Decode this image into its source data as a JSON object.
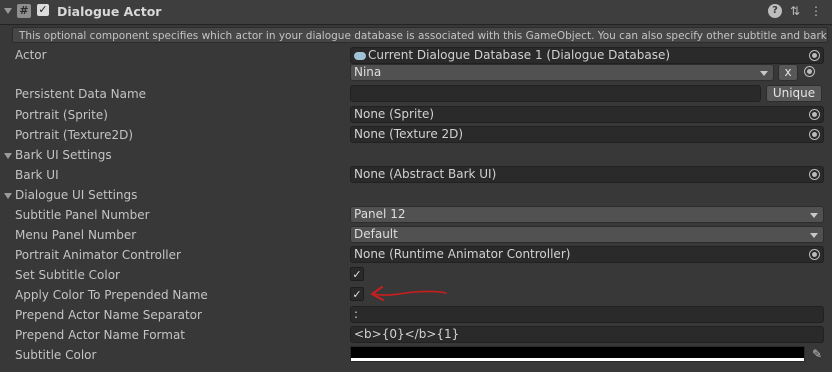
{
  "component": {
    "title": "Dialogue Actor",
    "enabled_check": "✓",
    "help_text": "This optional component specifies which actor in your dialogue database is associated with this GameObject. You can also specify other subtitle and bark settings."
  },
  "icons": {
    "component": "#",
    "help": "?",
    "presets": "⇅",
    "kebab": "⋮",
    "eyedropper": "✎"
  },
  "actor": {
    "label": "Actor",
    "database": "Current Dialogue Database 1 (Dialogue Database)",
    "selected": "Nina",
    "clear_label": "x"
  },
  "persistent": {
    "label": "Persistent Data Name",
    "value": "",
    "unique_label": "Unique"
  },
  "portrait_sprite": {
    "label": "Portrait (Sprite)",
    "value": "None (Sprite)"
  },
  "portrait_texture": {
    "label": "Portrait (Texture2D)",
    "value": "None (Texture 2D)"
  },
  "bark_section": {
    "label": "Bark UI Settings"
  },
  "bark_ui": {
    "label": "Bark UI",
    "value": "None (Abstract Bark UI)"
  },
  "dialogue_section": {
    "label": "Dialogue UI Settings"
  },
  "subtitle_panel": {
    "label": "Subtitle Panel Number",
    "value": "Panel 12"
  },
  "menu_panel": {
    "label": "Menu Panel Number",
    "value": "Default"
  },
  "portrait_animator": {
    "label": "Portrait Animator Controller",
    "value": "None (Runtime Animator Controller)"
  },
  "set_subtitle_color": {
    "label": "Set Subtitle Color",
    "checked": "✓"
  },
  "apply_color": {
    "label": "Apply Color To Prepended Name",
    "checked": "✓"
  },
  "prepend_separator": {
    "label": "Prepend Actor Name Separator",
    "value": ":"
  },
  "prepend_format": {
    "label": "Prepend Actor Name Format",
    "value": "<b>{0}</b>{1}"
  },
  "subtitle_color": {
    "label": "Subtitle Color",
    "color": "#000000"
  },
  "colors": {
    "annotation": "#c81e1e"
  }
}
